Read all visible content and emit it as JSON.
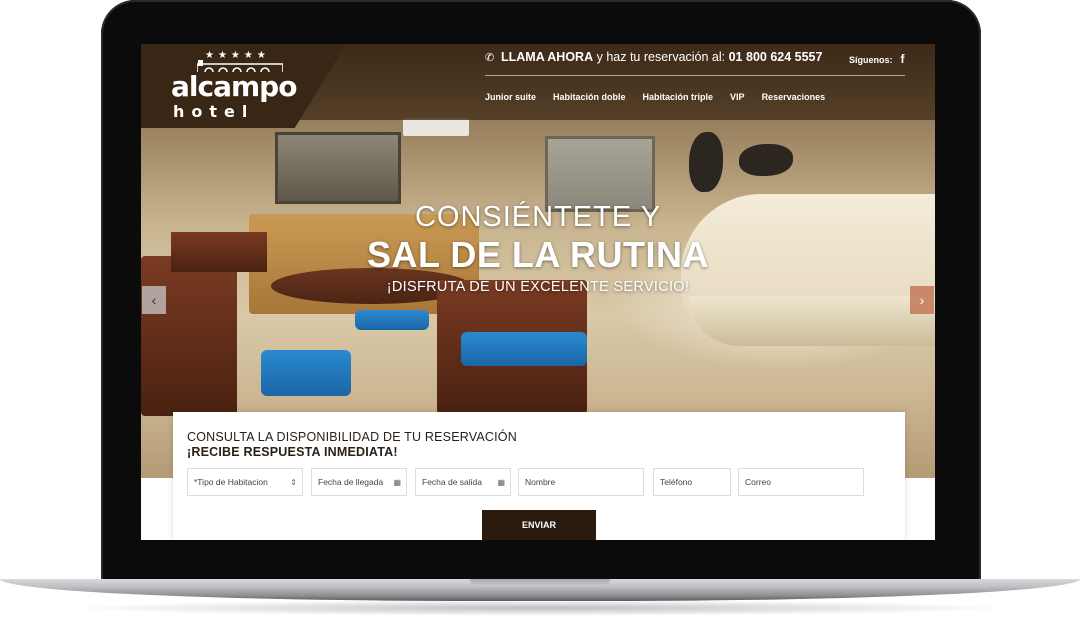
{
  "brand": {
    "logo_main": "alcampo",
    "logo_sub": "hotel",
    "logo_stars": "★★★★★"
  },
  "header": {
    "call_strong": "LLAMA AHORA",
    "call_text": " y haz tu reservación al: ",
    "call_number": "01 800 624 5557",
    "social_label": "Síguenos:",
    "social_icon": "f"
  },
  "nav": {
    "items": [
      "Junior suite",
      "Habitación doble",
      "Habitación triple",
      "VIP",
      "Reservaciones"
    ]
  },
  "hero": {
    "line1": "CONSIÉNTETE Y",
    "line2": "SAL DE LA RUTINA",
    "line3": "¡DISFRUTA DE UN EXCELENTE SERVICIO!",
    "prev": "‹",
    "next": "›"
  },
  "form": {
    "title1": "CONSULTA LA DISPONIBILIDAD DE TU RESERVACIÓN",
    "title2": "¡RECIBE RESPUESTA INMEDIATA!",
    "room_type": "*Tipo de Habitacion",
    "arrival": "Fecha de llegada",
    "departure": "Fecha de salida",
    "name": "Nombre",
    "phone": "Teléfono",
    "email": "Correo",
    "submit": "ENVIAR"
  },
  "colors": {
    "header_bg": "#3a2614",
    "button_bg": "#2b1a0e",
    "slider_next": "#c4785a"
  }
}
